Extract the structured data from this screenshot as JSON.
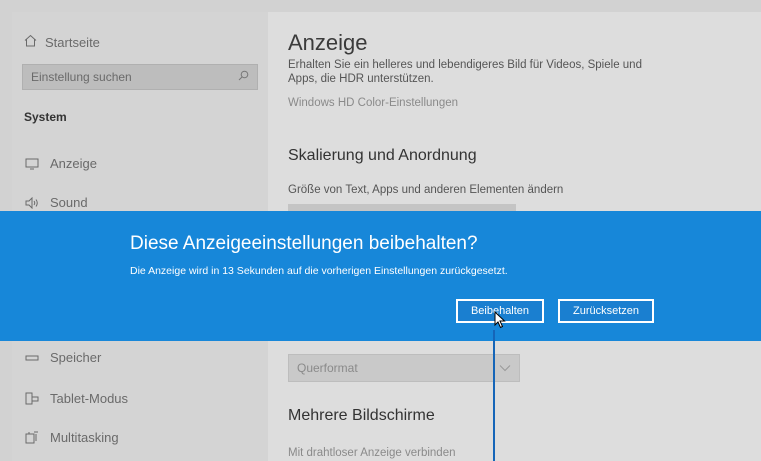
{
  "sidebar": {
    "home_label": "Startseite",
    "search_placeholder": "Einstellung suchen",
    "section_title": "System",
    "items": [
      {
        "label": "Anzeige",
        "icon": "monitor-icon"
      },
      {
        "label": "Sound",
        "icon": "speaker-icon"
      },
      {
        "label": "Speicher",
        "icon": "storage-icon"
      },
      {
        "label": "Tablet-Modus",
        "icon": "tablet-mode-icon"
      },
      {
        "label": "Multitasking",
        "icon": "multitasking-icon"
      }
    ]
  },
  "main": {
    "title": "Anzeige",
    "hdr_description": "Erhalten Sie ein helleres und lebendigeres Bild für Videos, Spiele und Apps, die HDR unterstützen.",
    "hdr_link": "Windows HD Color-Einstellungen",
    "scaling_heading": "Skalierung und Anordnung",
    "size_label": "Größe von Text, Apps und anderen Elementen ändern",
    "orientation_value": "Querformat",
    "multi_display_heading": "Mehrere Bildschirme",
    "wireless_link": "Mit drahtloser Anzeige verbinden"
  },
  "dialog": {
    "title": "Diese Anzeigeeinstellungen beibehalten?",
    "message": "Die Anzeige wird in 13 Sekunden auf die vorherigen Einstellungen zurückgesetzt.",
    "keep_label": "Beibehalten",
    "revert_label": "Zurücksetzen"
  },
  "colors": {
    "dialog_bg": "#1787d9",
    "cursor_line": "#1565b8"
  }
}
